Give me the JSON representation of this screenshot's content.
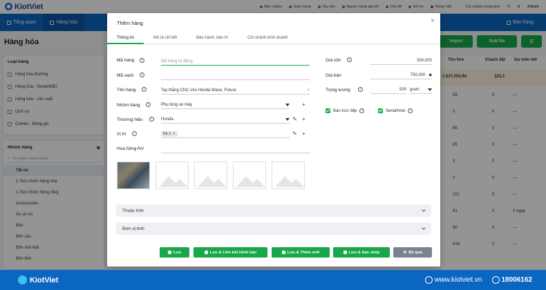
{
  "app": {
    "brand": "KiotViet"
  },
  "topbar": {
    "items": [
      "Bán online",
      "Giao hàng",
      "Vay vốn",
      "Nguồn hàng giá tốt",
      "Chủ đề",
      "Hỗ trợ",
      "Tiếng Việt"
    ],
    "branch": "Chi nhánh trung tâm",
    "user": "Admin"
  },
  "nav": {
    "items": [
      "Tổng quan",
      "Hàng hóa"
    ],
    "right": "Bán hàng"
  },
  "page": {
    "title": "Hàng hóa"
  },
  "filters": {
    "type_title": "Loại hàng",
    "types": [
      "Hàng hóa thường",
      "Hàng hóa - Serial/IMEI",
      "Hàng hóa - sản xuất",
      "Dịch vụ",
      "Combo - Đóng gói"
    ],
    "group_title": "Nhóm hàng",
    "group_search_placeholder": "Tìm kiếm nhóm hàng",
    "groups": [
      "Tất cả",
      "1-Test nhóm hàng cha",
      "1-Test nhóm hàng rỗng",
      "Accessories",
      "Áo sơ mi",
      "Bàn",
      "Bồn cầu",
      "Bồn rửa mặt",
      "Bồn tắm"
    ]
  },
  "toolbar": {
    "import": "Import",
    "export": "Xuất file"
  },
  "table": {
    "headers": [
      "Tồn kho",
      "Khách đặt",
      "Dự kiến hết"
    ],
    "summary": {
      "stock": "1,537,003,94",
      "ordered": "323,3"
    },
    "rows": [
      {
        "stock": "58",
        "ordered": "0",
        "eta": "---"
      },
      {
        "stock": "0",
        "ordered": "0",
        "eta": "---"
      },
      {
        "stock": "65",
        "ordered": "0",
        "eta": "---"
      },
      {
        "stock": "65",
        "ordered": "0",
        "eta": "---"
      },
      {
        "stock": "0",
        "ordered": "0",
        "eta": "---"
      },
      {
        "stock": "0",
        "ordered": "0",
        "eta": "---"
      },
      {
        "stock": "151",
        "ordered": "0",
        "eta": "---"
      },
      {
        "stock": "61",
        "ordered": "0",
        "eta": "0 ngày"
      },
      {
        "stock": "90",
        "ordered": "0",
        "eta": "---"
      },
      {
        "stock": "619",
        "ordered": "0",
        "eta": "---"
      }
    ]
  },
  "modal": {
    "title": "Thêm hàng",
    "tabs": [
      "Thông tin",
      "Mô tả chi tiết",
      "Bảo hành, bảo trì",
      "Chi nhánh kinh doanh"
    ],
    "fields": {
      "code_label": "Mã hàng",
      "code_placeholder": "Mã hàng tự động",
      "barcode_label": "Mã vạch",
      "name_label": "Tên hàng",
      "name_value": "Tay thắng CNC cho Honda Wave, Future",
      "group_label": "Nhóm hàng",
      "group_value": "Phụ tùng xe máy",
      "brand_label": "Thương hiệu",
      "brand_value": "Honda",
      "location_label": "Vị trí",
      "location_tag": "Kệ 1",
      "commission_label": "Hoa hồng NV",
      "cost_label": "Giá vốn",
      "cost_value": "500,000",
      "price_label": "Giá bán",
      "price_value": "750,000",
      "weight_label": "Trọng lượng",
      "weight_value": "500",
      "weight_unit": "gram",
      "direct_sale": "Bán trực tiếp",
      "serial": "Serial/Imei"
    },
    "sections": [
      "Thuộc tính",
      "Đơn vị tính"
    ],
    "buttons": {
      "save": "Lưu",
      "save_link": "Lưu & Liên kết kênh bán",
      "save_new": "Lưu & Thêm mới",
      "save_copy": "Lưu & Sao chép",
      "skip": "Bỏ qua"
    }
  },
  "footer": {
    "brand": "KiotViet",
    "site": "www.kiotviet.vn",
    "phone": "18006162"
  }
}
